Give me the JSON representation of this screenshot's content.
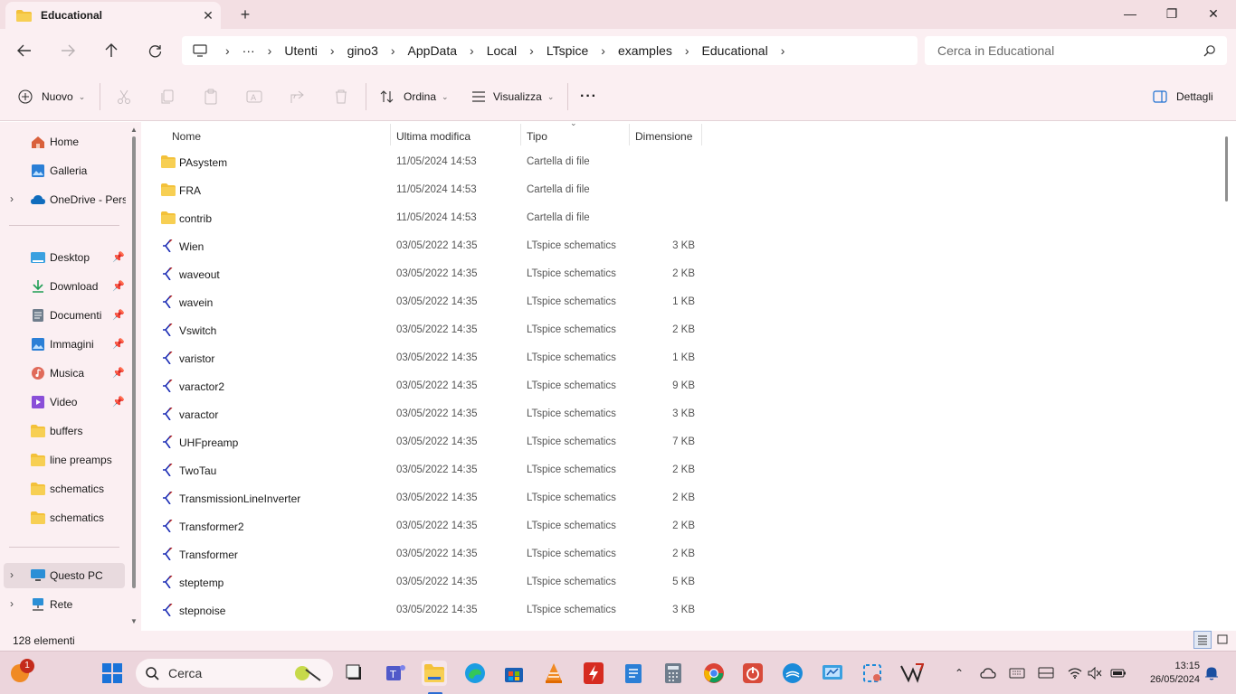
{
  "window": {
    "tab_title": "Educational",
    "new_tab": "+",
    "minimize": "—",
    "maximize": "❐",
    "close": "✕"
  },
  "address": {
    "crumbs": [
      "Utenti",
      "gino3",
      "AppData",
      "Local",
      "LTspice",
      "examples",
      "Educational"
    ],
    "search_placeholder": "Cerca in Educational"
  },
  "toolbar": {
    "new_label": "Nuovo",
    "sort_label": "Ordina",
    "view_label": "Visualizza",
    "more_label": "···",
    "details_label": "Dettagli"
  },
  "sidebar": {
    "items": [
      {
        "label": "Home",
        "icon": "home-icon",
        "color": "#d9603b"
      },
      {
        "label": "Galleria",
        "icon": "gallery-icon",
        "color": "#2b7fd6"
      },
      {
        "label": "OneDrive - Personale",
        "icon": "onedrive-icon",
        "color": "#0f6cbd"
      },
      {
        "label": "Desktop",
        "icon": "desktop-icon",
        "color": "#3aa0e0"
      },
      {
        "label": "Download",
        "icon": "download-icon",
        "color": "#1f9d55"
      },
      {
        "label": "Documenti",
        "icon": "documents-icon",
        "color": "#6f7d8c"
      },
      {
        "label": "Immagini",
        "icon": "pictures-icon",
        "color": "#2b7fd6"
      },
      {
        "label": "Musica",
        "icon": "music-icon",
        "color": "#e06a5a"
      },
      {
        "label": "Video",
        "icon": "video-icon",
        "color": "#8a4fd8"
      },
      {
        "label": "buffers",
        "icon": "folder-icon",
        "color": "#f3c13a"
      },
      {
        "label": "line preamps",
        "icon": "folder-icon",
        "color": "#f3c13a"
      },
      {
        "label": "schematics",
        "icon": "folder-icon",
        "color": "#f3c13a"
      },
      {
        "label": "schematics",
        "icon": "folder-icon",
        "color": "#f3c13a"
      },
      {
        "label": "Questo PC",
        "icon": "this-pc-icon",
        "color": "#2b8fd6"
      },
      {
        "label": "Rete",
        "icon": "network-icon",
        "color": "#2b8fd6"
      }
    ]
  },
  "columns": {
    "name": "Nome",
    "modified": "Ultima modifica",
    "type": "Tipo",
    "size": "Dimensione"
  },
  "files": [
    {
      "name": "PAsystem",
      "date": "11/05/2024 14:53",
      "type": "Cartella di file",
      "size": "",
      "kind": "folder"
    },
    {
      "name": "FRA",
      "date": "11/05/2024 14:53",
      "type": "Cartella di file",
      "size": "",
      "kind": "folder"
    },
    {
      "name": "contrib",
      "date": "11/05/2024 14:53",
      "type": "Cartella di file",
      "size": "",
      "kind": "folder"
    },
    {
      "name": "Wien",
      "date": "03/05/2022 14:35",
      "type": "LTspice schematics",
      "size": "3 KB",
      "kind": "schematic"
    },
    {
      "name": "waveout",
      "date": "03/05/2022 14:35",
      "type": "LTspice schematics",
      "size": "2 KB",
      "kind": "schematic"
    },
    {
      "name": "wavein",
      "date": "03/05/2022 14:35",
      "type": "LTspice schematics",
      "size": "1 KB",
      "kind": "schematic"
    },
    {
      "name": "Vswitch",
      "date": "03/05/2022 14:35",
      "type": "LTspice schematics",
      "size": "2 KB",
      "kind": "schematic"
    },
    {
      "name": "varistor",
      "date": "03/05/2022 14:35",
      "type": "LTspice schematics",
      "size": "1 KB",
      "kind": "schematic"
    },
    {
      "name": "varactor2",
      "date": "03/05/2022 14:35",
      "type": "LTspice schematics",
      "size": "9 KB",
      "kind": "schematic"
    },
    {
      "name": "varactor",
      "date": "03/05/2022 14:35",
      "type": "LTspice schematics",
      "size": "3 KB",
      "kind": "schematic"
    },
    {
      "name": "UHFpreamp",
      "date": "03/05/2022 14:35",
      "type": "LTspice schematics",
      "size": "7 KB",
      "kind": "schematic"
    },
    {
      "name": "TwoTau",
      "date": "03/05/2022 14:35",
      "type": "LTspice schematics",
      "size": "2 KB",
      "kind": "schematic"
    },
    {
      "name": "TransmissionLineInverter",
      "date": "03/05/2022 14:35",
      "type": "LTspice schematics",
      "size": "2 KB",
      "kind": "schematic"
    },
    {
      "name": "Transformer2",
      "date": "03/05/2022 14:35",
      "type": "LTspice schematics",
      "size": "2 KB",
      "kind": "schematic"
    },
    {
      "name": "Transformer",
      "date": "03/05/2022 14:35",
      "type": "LTspice schematics",
      "size": "2 KB",
      "kind": "schematic"
    },
    {
      "name": "steptemp",
      "date": "03/05/2022 14:35",
      "type": "LTspice schematics",
      "size": "5 KB",
      "kind": "schematic"
    },
    {
      "name": "stepnoise",
      "date": "03/05/2022 14:35",
      "type": "LTspice schematics",
      "size": "3 KB",
      "kind": "schematic"
    }
  ],
  "status": {
    "count": "128 elementi"
  },
  "taskbar": {
    "search_placeholder": "Cerca",
    "notification_badge": "1",
    "time": "13:15",
    "date": "26/05/2024"
  },
  "colors": {
    "accent": "#2b6cd3",
    "chrome": "#fbeff2",
    "folder": "#f3c13a",
    "ltspice": "#1c2db5"
  }
}
